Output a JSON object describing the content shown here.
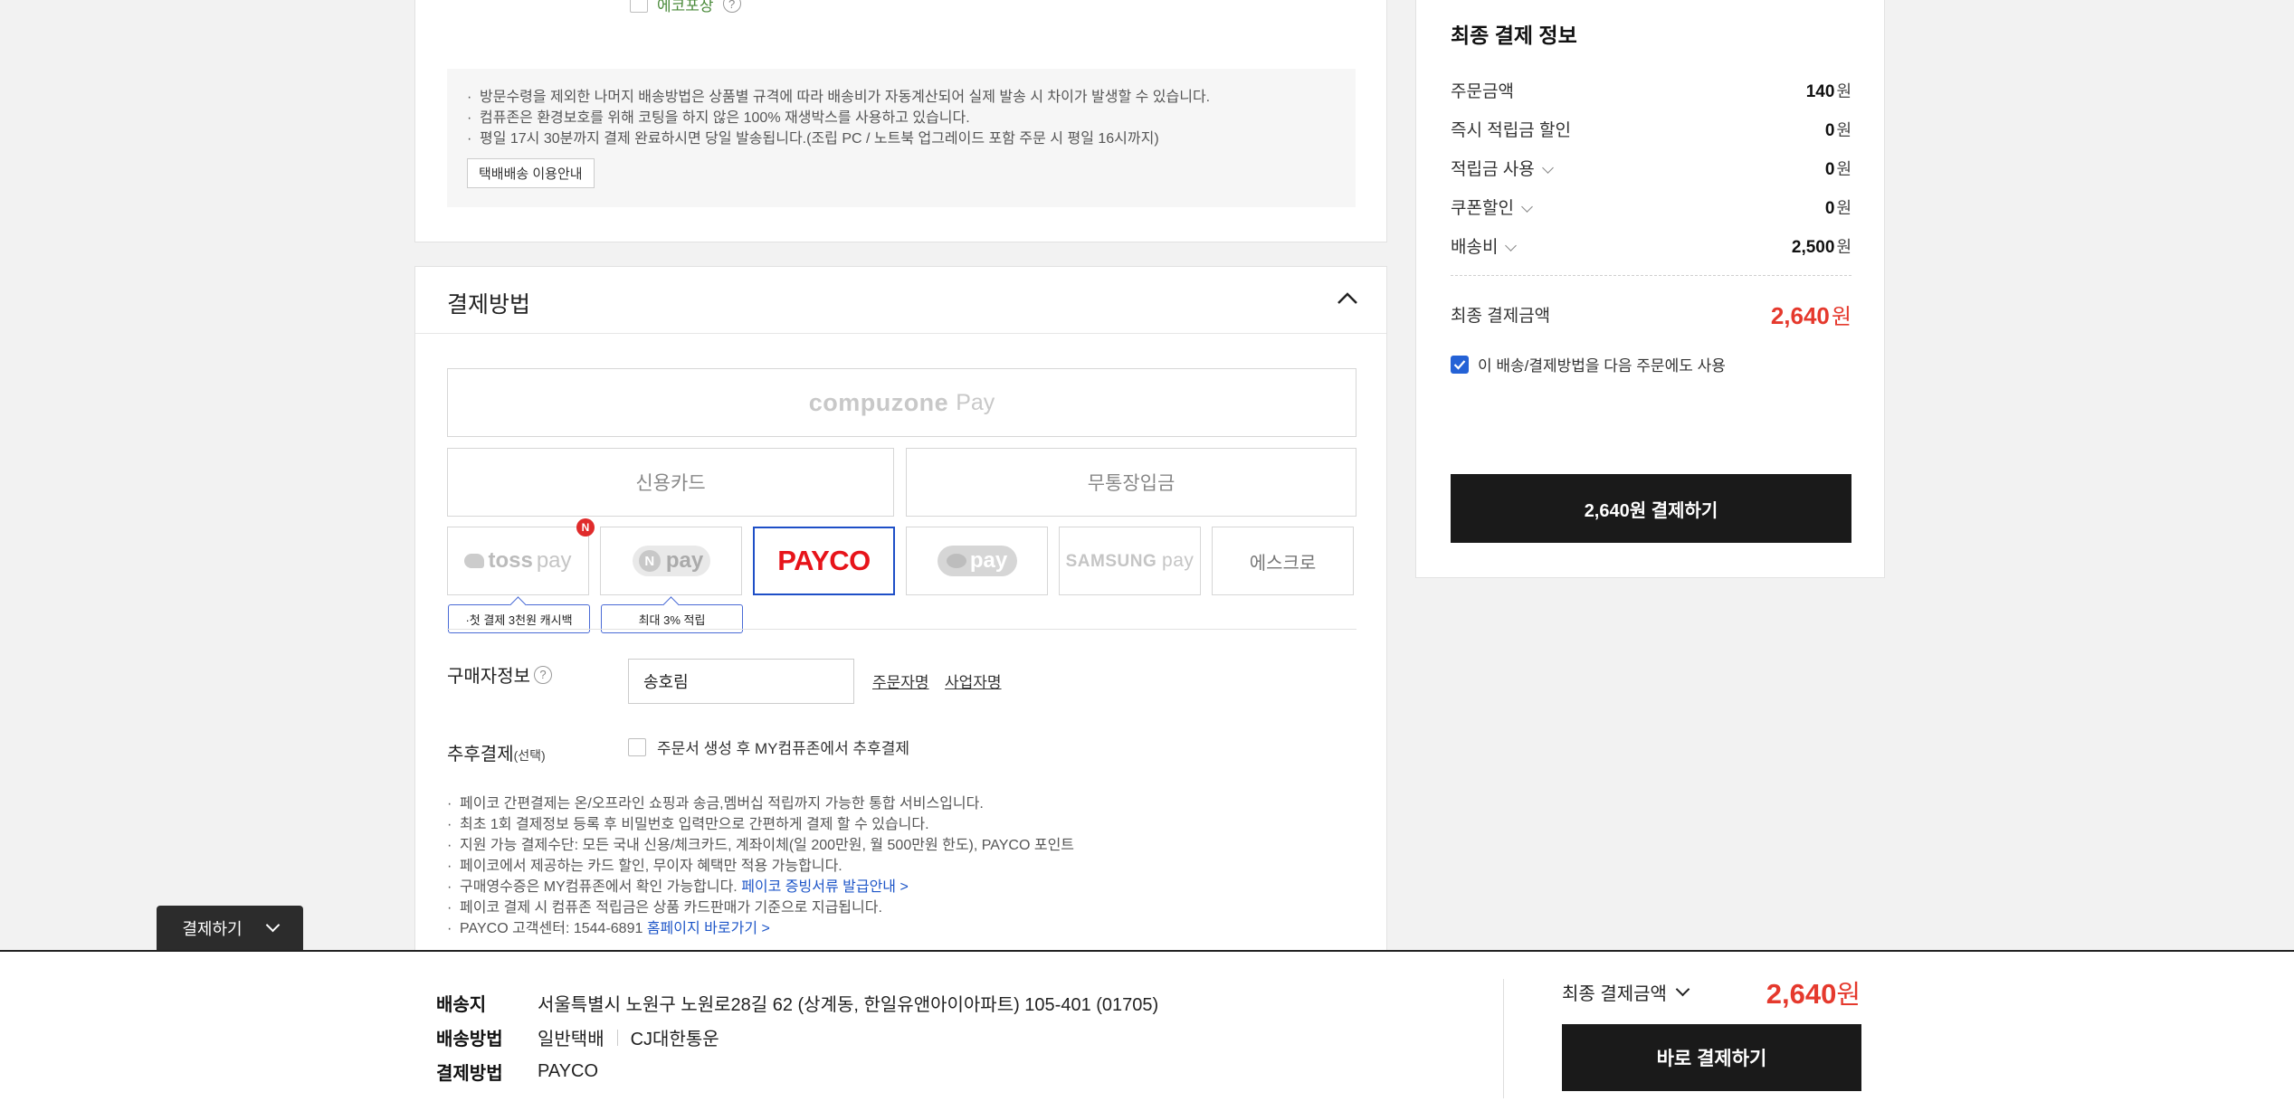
{
  "delivery": {
    "eco_label": "에코포장",
    "notices": [
      "방문수령을 제외한 나머지 배송방법은 상품별 규격에 따라 배송비가 자동계산되어 실제 발송 시 차이가 발생할 수 있습니다.",
      "컴퓨존은 환경보호를 위해 코팅을 하지 않은 100% 재생박스를 사용하고 있습니다.",
      "평일 17시 30분까지 결제 완료하시면 당일 발송됩니다.(조립 PC / 노트북 업그레이드 포함 주문 시 평일 16시까지)"
    ],
    "parcel_guide_label": "택배배송 이용안내"
  },
  "payment": {
    "title": "결제방법",
    "compuzone_pay": {
      "brand": "compuzone",
      "suffix": "Pay"
    },
    "credit_card": "신용카드",
    "bank_transfer": "무통장입금",
    "toss": {
      "brand": "toss",
      "suffix": "pay"
    },
    "npay": {
      "badge": "N",
      "text": "pay"
    },
    "payco": "PAYCO",
    "kakaopay": "pay",
    "samsungpay": {
      "brand": "SAMSUNG",
      "suffix": "pay"
    },
    "escrow": "에스크로",
    "new_badge": "N",
    "tip_toss": "·첫 결제 3천원 캐시백",
    "tip_npay": "최대 3% 적립",
    "buyer_label": "구매자정보",
    "buyer_name": "송호림",
    "link_orderer": "주문자명",
    "link_business": "사업자명",
    "later_label": "추후결제",
    "later_optional": "(선택)",
    "later_checkbox": "주문서 생성 후 MY컴퓨존에서 추후결제",
    "notes": [
      "페이코 간편결제는 온/오프라인 쇼핑과 송금,멤버십 적립까지 가능한 통합 서비스입니다.",
      "최초 1회 결제정보 등록 후 비밀번호 입력만으로 간편하게 결제 할 수 있습니다.",
      "지원 가능 결제수단: 모든 국내 신용/체크카드, 계좌이체(일 200만원, 월 500만원 한도), PAYCO 포인트",
      "페이코에서 제공하는 카드 할인, 무이자 혜택만 적용 가능합니다.",
      "구매영수증은 MY컴퓨존에서 확인 가능합니다.",
      "페이코 결제 시 컴퓨존 적립금은 상품 카드판매가 기준으로 지급됩니다.",
      "PAYCO 고객센터: 1544-6891"
    ],
    "note_link_receipt": "페이코 증빙서류 발급안내 >",
    "note_link_home": "홈페이지 바로가기 >"
  },
  "summary": {
    "title": "최종 결제 정보",
    "rows": [
      {
        "label": "주문금액",
        "value": "140",
        "unit": "원"
      },
      {
        "label": "즉시 적립금 할인",
        "value": "0",
        "unit": "원"
      },
      {
        "label": "적립금 사용",
        "value": "0",
        "unit": "원"
      },
      {
        "label": "쿠폰할인",
        "value": "0",
        "unit": "원"
      },
      {
        "label": "배송비",
        "value": "2,500",
        "unit": "원"
      }
    ],
    "final_label": "최종 결제금액",
    "final_value": "2,640",
    "final_unit": "원",
    "save_method_label": "이 배송/결제방법을 다음 주문에도 사용",
    "pay_button": "2,640원 결제하기"
  },
  "float_toggle": "결제하기",
  "bottom_bar": {
    "address_key": "배송지",
    "address_value": "서울특별시 노원구 노원로28길 62 (상계동, 한일유앤아이아파트) 105-401 (01705)",
    "method_key": "배송방법",
    "method_value": "일반택배",
    "courier": "CJ대한통운",
    "payment_key": "결제방법",
    "payment_value": "PAYCO",
    "final_label": "최종 결제금액",
    "final_value": "2,640",
    "final_unit": "원",
    "pay_now": "바로 결제하기"
  },
  "colors": {
    "accent_red": "#e5392d",
    "payco_red": "#e7141a",
    "select_blue": "#1e4fc7",
    "dark_button": "#1a1a1a"
  }
}
